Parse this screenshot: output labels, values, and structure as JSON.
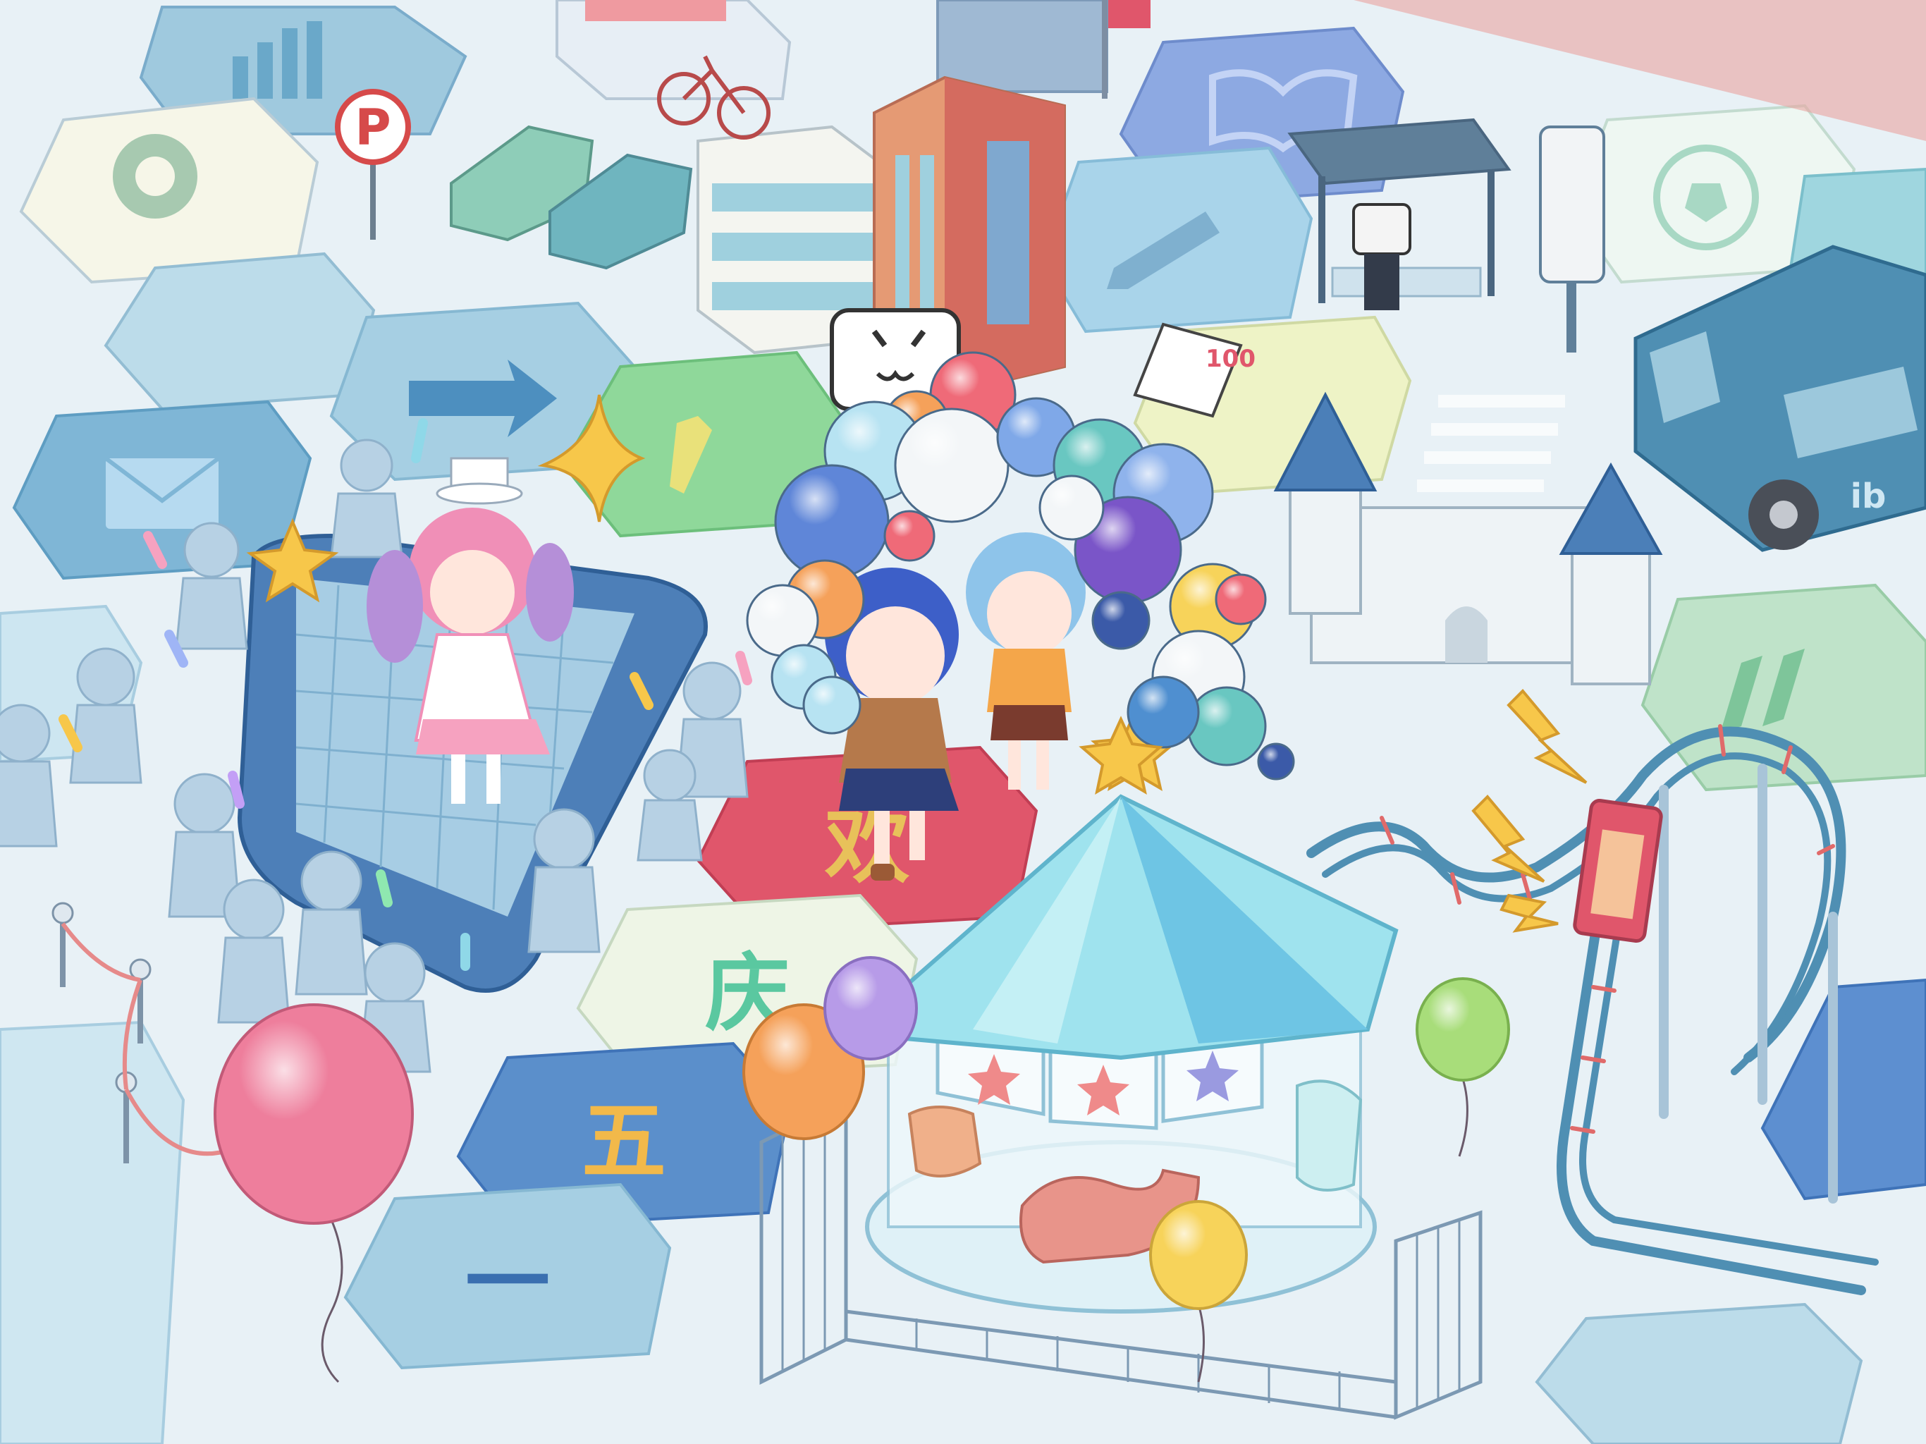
{
  "scene": {
    "description_tiles": [
      "settings",
      "chart",
      "arrow",
      "mail",
      "tie",
      "book",
      "pencil",
      "soccer",
      "pause"
    ],
    "word_tiles": [
      {
        "char": "欢",
        "color": "#e8c15a"
      },
      {
        "char": "庆",
        "color": "#5ac8a0"
      },
      {
        "char": "五",
        "color": "#f2b94a"
      },
      {
        "char": "一",
        "color": "#3a6fb0"
      }
    ],
    "parking_sign": "P",
    "bus_badge": "ib",
    "test_paper_score": "100",
    "colors": {
      "ground": "#e8f1f6",
      "tile_blue": "#7fb6d6",
      "tile_pale": "#cde6f1",
      "tile_red": "#e0566b",
      "tile_green": "#8fd89a",
      "accent_pink": "#ef7fa0",
      "accent_yellow": "#f7c74a"
    },
    "icons": [
      "gear-icon",
      "bar-chart-icon",
      "arrow-right-icon",
      "envelope-icon",
      "tie-icon",
      "book-icon",
      "pencil-icon",
      "soccer-ball-icon",
      "pause-icon",
      "star-icon",
      "lightning-icon"
    ]
  }
}
